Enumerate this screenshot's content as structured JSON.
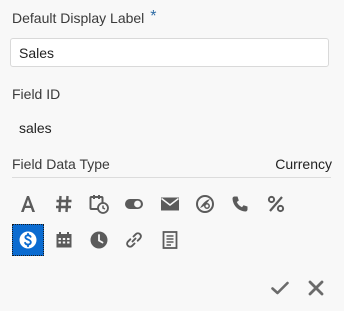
{
  "form": {
    "display_label": {
      "label": "Default Display Label",
      "required_mark": "*",
      "value": "Sales"
    },
    "field_id": {
      "label": "Field ID",
      "value": "sales"
    },
    "data_type": {
      "label": "Field Data Type",
      "value": "Currency"
    }
  },
  "type_icons": [
    {
      "name": "text-icon",
      "type": "Text",
      "selected": false
    },
    {
      "name": "number-icon",
      "type": "Number",
      "selected": false
    },
    {
      "name": "datetime-icon",
      "type": "Date Time",
      "selected": false
    },
    {
      "name": "boolean-toggle-icon",
      "type": "Boolean",
      "selected": false
    },
    {
      "name": "email-icon",
      "type": "Email",
      "selected": false
    },
    {
      "name": "uri-icon",
      "type": "URI",
      "selected": false
    },
    {
      "name": "phone-icon",
      "type": "Phone",
      "selected": false
    },
    {
      "name": "percentage-icon",
      "type": "Percentage",
      "selected": false
    },
    {
      "name": "currency-icon",
      "type": "Currency",
      "selected": true
    },
    {
      "name": "date-icon",
      "type": "Date",
      "selected": false
    },
    {
      "name": "time-icon",
      "type": "Time",
      "selected": false
    },
    {
      "name": "url-link-icon",
      "type": "URL",
      "selected": false
    },
    {
      "name": "long-text-icon",
      "type": "Long Text",
      "selected": false
    }
  ],
  "colors": {
    "accent": "#0b6bd0",
    "required": "#2e6ca5",
    "icon": "#5b5b5b",
    "background": "#f8f8f8"
  },
  "footer": {
    "confirm_icon": "check-icon",
    "cancel_icon": "close-icon"
  }
}
